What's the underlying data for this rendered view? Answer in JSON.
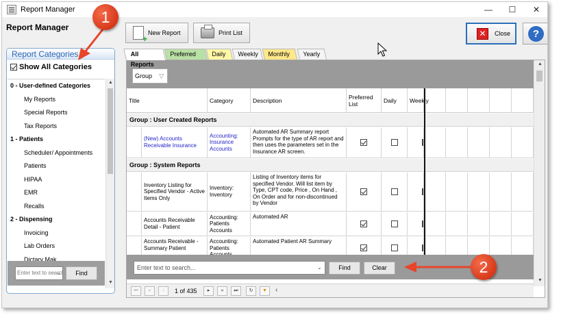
{
  "window": {
    "title": "Report Manager",
    "controls": {
      "minimize": "—",
      "maximize": "☐",
      "close": "✕"
    }
  },
  "page_title": "Report Manager",
  "categories": {
    "header": "Report Categories",
    "show_all_label": "Show All Categories",
    "show_all_checked": true,
    "items": [
      {
        "label": "0 - User-defined Categories",
        "type": "group"
      },
      {
        "label": "My Reports",
        "type": "item"
      },
      {
        "label": "Special Reports",
        "type": "item"
      },
      {
        "label": "Tax Reports",
        "type": "item"
      },
      {
        "label": "1 - Patients",
        "type": "group"
      },
      {
        "label": "Scheduler/ Appointments",
        "type": "item"
      },
      {
        "label": "Patients",
        "type": "item"
      },
      {
        "label": "HIPAA",
        "type": "item"
      },
      {
        "label": "EMR",
        "type": "item"
      },
      {
        "label": "Recalls",
        "type": "item"
      },
      {
        "label": "2 - Dispensing",
        "type": "group"
      },
      {
        "label": "Invoicing",
        "type": "item"
      },
      {
        "label": "Lab Orders",
        "type": "item"
      },
      {
        "label": "Dictary Mak",
        "type": "item"
      }
    ],
    "search_placeholder": "Enter text to search...",
    "find_label": "Find"
  },
  "toolbar": {
    "new_report_label": "New Report",
    "print_list_label": "Print List",
    "close_label": "Close",
    "help_label": "?"
  },
  "tabs": [
    {
      "label": "All Reports",
      "color": "#ffffff",
      "active": true
    },
    {
      "label": "Preferred",
      "color": "#b9e0a5",
      "active": false
    },
    {
      "label": "Daily",
      "color": "#fff7a8",
      "active": false
    },
    {
      "label": "Weekly",
      "color": "#f4f4f4",
      "active": false
    },
    {
      "label": "Monthly",
      "color": "#ffe78a",
      "active": false
    },
    {
      "label": "Yearly",
      "color": "#f4f4f4",
      "active": false
    }
  ],
  "grid": {
    "group_chip": "Group",
    "columns": [
      "Title",
      "Category",
      "Description",
      "Preferred\nList",
      "Daily",
      "Weekly"
    ],
    "groups": [
      {
        "label": "Group : User Created Reports",
        "rows": [
          {
            "title": "(New) Accounts Receivable Insurance",
            "category": "Accounting: Insurance Accounts",
            "description": "Automated AR Summary report Prompts for the type of AR report and then uses the parameters set in the Insurance AR screen.",
            "preferred": true,
            "daily": false,
            "link": true
          }
        ]
      },
      {
        "label": "Group : System Reports",
        "rows": [
          {
            "title": "Inventory Listing for Specified Vendor - Active Items Only",
            "category": "Inventory: Inventory",
            "description": "Listing of Inventory items for specified Vendor. Will list item by Type, CPT code, Price , On Hand , On Order and for non-discontinued by Vendor",
            "preferred": true,
            "daily": false,
            "link": false
          },
          {
            "title": "Accounts Receivable Detail - Patient",
            "category": "Accounting: Patients Accounts",
            "description": "Automated AR",
            "preferred": true,
            "daily": false,
            "link": false
          },
          {
            "title": "Accounts Receivable - Summary Patient",
            "category": "Accounting: Patients Accounts",
            "description": "Automated Patient AR Summary",
            "preferred": true,
            "daily": false,
            "link": false
          }
        ]
      }
    ],
    "search_placeholder": "Enter text to search...",
    "find_label": "Find",
    "clear_label": "Clear",
    "pager_text": "1 of 435"
  },
  "annotations": {
    "badge1": "1",
    "badge2": "2",
    "arrow_color": "#e8452a"
  }
}
